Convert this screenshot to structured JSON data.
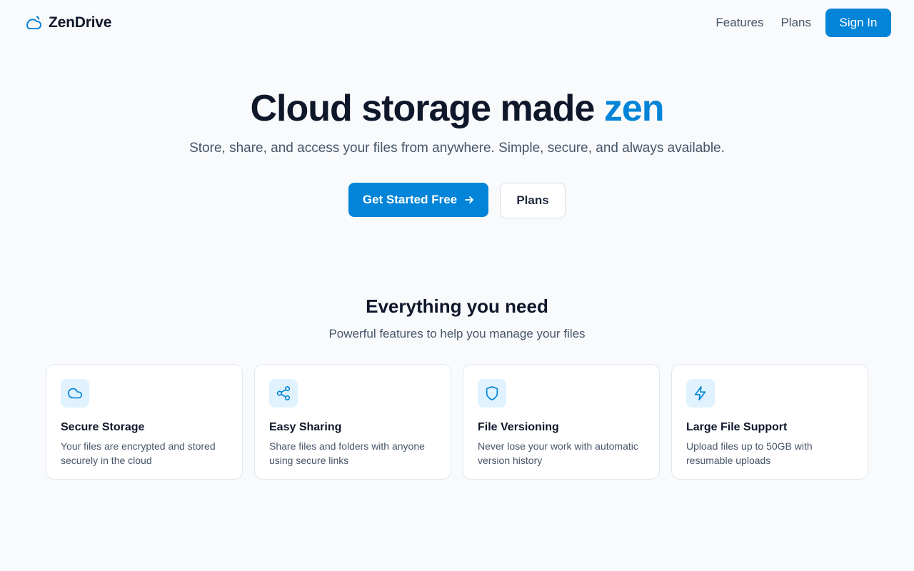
{
  "header": {
    "brand_name": "ZenDrive",
    "brand_icon": "cloud-icon",
    "nav": [
      {
        "label": "Features"
      },
      {
        "label": "Plans"
      }
    ],
    "signin_label": "Sign In"
  },
  "hero": {
    "title_main": "Cloud storage made ",
    "title_accent": "zen",
    "subtitle": "Store, share, and access your files from anywhere. Simple, secure, and always available.",
    "primary_label": "Get Started Free",
    "primary_icon": "arrow-right-icon",
    "secondary_label": "Plans"
  },
  "features": {
    "title": "Everything you need",
    "subtitle": "Powerful features to help you manage your files",
    "cards": [
      {
        "icon": "cloud-icon",
        "title": "Secure Storage",
        "desc": "Your files are encrypted and stored securely in the cloud"
      },
      {
        "icon": "share-icon",
        "title": "Easy Sharing",
        "desc": "Share files and folders with anyone using secure links"
      },
      {
        "icon": "shield-icon",
        "title": "File Versioning",
        "desc": "Never lose your work with automatic version history"
      },
      {
        "icon": "lightning-icon",
        "title": "Large File Support",
        "desc": "Upload files up to 50GB with resumable uploads"
      }
    ]
  },
  "colors": {
    "accent": "#0284d8",
    "background": "#f8fafc",
    "text": "#0f172a",
    "muted": "#475569",
    "icon_bg": "#e0f2fe"
  }
}
